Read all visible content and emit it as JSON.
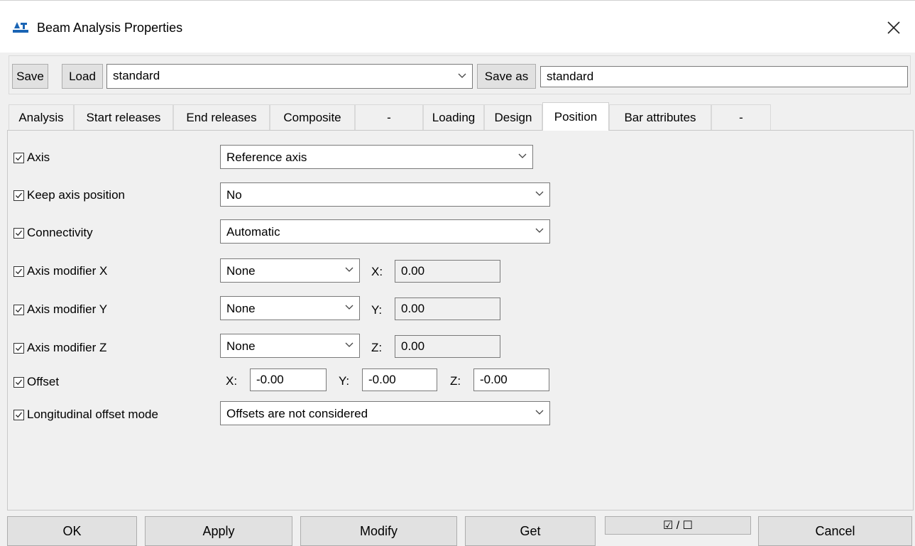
{
  "window": {
    "title": "Beam Analysis Properties",
    "close_glyph": "✕"
  },
  "toolbar": {
    "save_label": "Save",
    "load_label": "Load",
    "preset_value": "standard",
    "save_as_label": "Save as",
    "save_as_value": "standard"
  },
  "tabs": [
    {
      "label": "Analysis"
    },
    {
      "label": "Start releases"
    },
    {
      "label": "End releases"
    },
    {
      "label": "Composite"
    },
    {
      "label": "-"
    },
    {
      "label": "Loading"
    },
    {
      "label": "Design"
    },
    {
      "label": "Position",
      "active": true
    },
    {
      "label": "Bar attributes"
    },
    {
      "label": "-"
    }
  ],
  "position": {
    "axis": {
      "label": "Axis",
      "value": "Reference axis",
      "checked": true
    },
    "keep_axis_position": {
      "label": "Keep axis position",
      "value": "No",
      "checked": true
    },
    "connectivity": {
      "label": "Connectivity",
      "value": "Automatic",
      "checked": true
    },
    "axis_modifier_x": {
      "label": "Axis modifier X",
      "value": "None",
      "coord_label": "X:",
      "coord_value": "0.00",
      "checked": true
    },
    "axis_modifier_y": {
      "label": "Axis modifier Y",
      "value": "None",
      "coord_label": "Y:",
      "coord_value": "0.00",
      "checked": true
    },
    "axis_modifier_z": {
      "label": "Axis modifier Z",
      "value": "None",
      "coord_label": "Z:",
      "coord_value": "0.00",
      "checked": true
    },
    "offset": {
      "label": "Offset",
      "checked": true,
      "x_label": "X:",
      "x_value": "-0.00",
      "y_label": "Y:",
      "y_value": "-0.00",
      "z_label": "Z:",
      "z_value": "-0.00"
    },
    "longitudinal_offset_mode": {
      "label": "Longitudinal offset mode",
      "value": "Offsets are not considered",
      "checked": true
    }
  },
  "buttons": {
    "ok": "OK",
    "apply": "Apply",
    "modify": "Modify",
    "get": "Get",
    "toggle": "☑ / ☐",
    "cancel": "Cancel"
  },
  "icons": [
    "app-icon",
    "close-icon",
    "chevron-down-icon",
    "checkmark-icon"
  ]
}
